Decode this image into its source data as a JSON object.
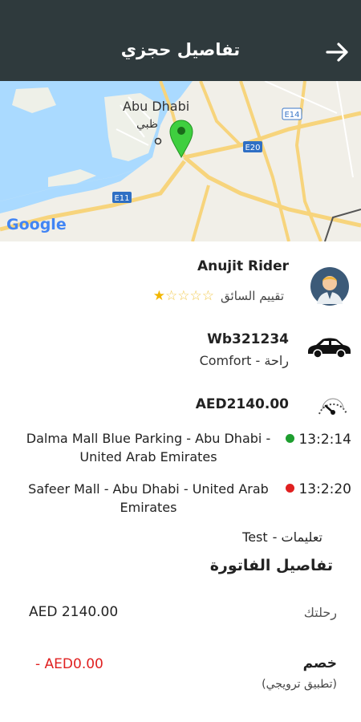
{
  "header": {
    "title": "تفاصيل حجزي",
    "back_icon": "arrow-right-icon"
  },
  "map": {
    "city_en": "Abu Dhabi",
    "city_ar": "ظبي",
    "road_labels": [
      "E14",
      "E20",
      "E11"
    ],
    "provider": "Google"
  },
  "driver": {
    "name": "Anujit Rider",
    "rating_label": "تقييم السائق",
    "rating": 1,
    "rating_max": 5
  },
  "vehicle": {
    "plate": "Wb321234",
    "type": "Comfort - راحة"
  },
  "fare": {
    "amount": "AED2140.00"
  },
  "pickup": {
    "address": "Dalma Mall Blue Parking - Abu Dhabi - United Arab Emirates",
    "time": "13:2:14",
    "dot_color": "#1e9e2f"
  },
  "dropoff": {
    "address": "Safeer Mall - Abu Dhabi - United Arab Emirates",
    "time": "13:2:20",
    "dot_color": "#e02020"
  },
  "notes": {
    "label": "تعليمات -",
    "value": "Test"
  },
  "invoice": {
    "title": "تفاصيل الفاتورة",
    "trip_label": "رحلتك",
    "trip_value": "AED 2140.00",
    "discount_label": "خصم",
    "discount_sub": "(تطبيق ترويجي)",
    "discount_value": "- AED0.00"
  },
  "colors": {
    "header_bg": "#2f3a3d",
    "accent_red": "#e02020",
    "star": "#f2b600"
  }
}
